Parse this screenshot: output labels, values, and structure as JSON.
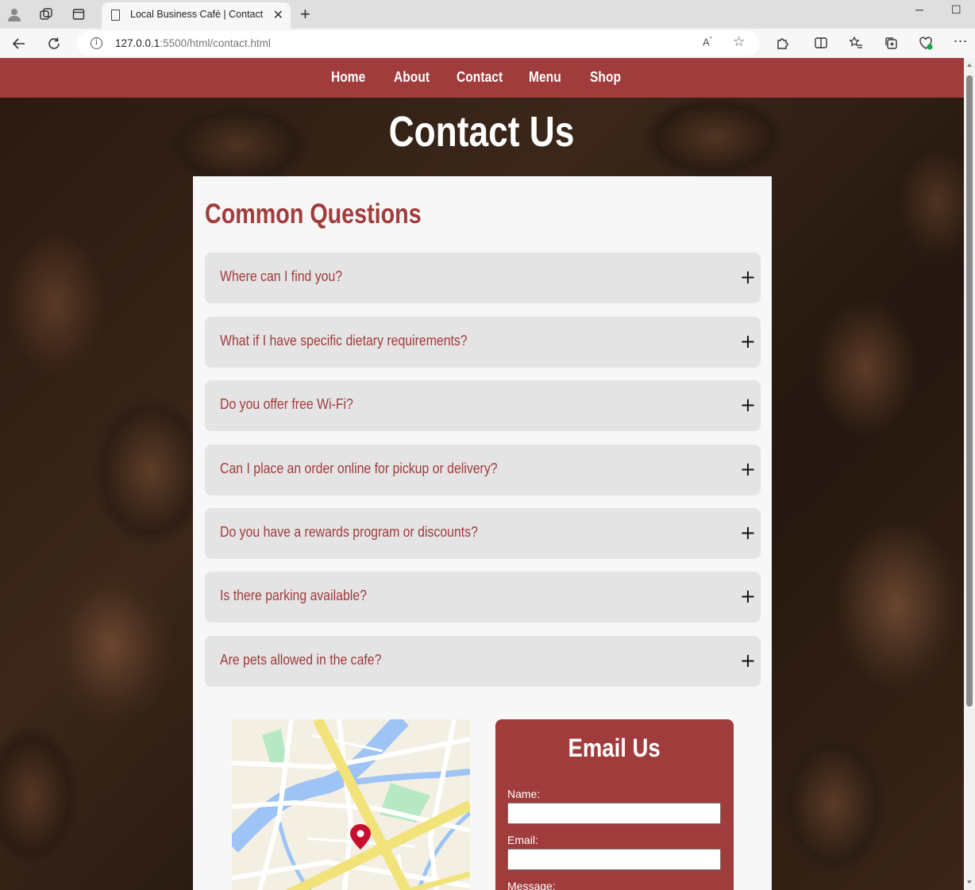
{
  "browser": {
    "tab_title": "Local Business Café | Contact",
    "url_host": "127.0.0.1",
    "url_rest": ":5500/html/contact.html"
  },
  "nav": {
    "items": [
      {
        "label": "Home"
      },
      {
        "label": "About"
      },
      {
        "label": "Contact"
      },
      {
        "label": "Menu"
      },
      {
        "label": "Shop"
      }
    ]
  },
  "hero": {
    "title": "Contact Us"
  },
  "faq": {
    "title": "Common Questions",
    "expand_symbol": "+",
    "items": [
      {
        "question": "Where can I find you?"
      },
      {
        "question": "What if I have specific dietary requirements?"
      },
      {
        "question": "Do you offer free Wi-Fi?"
      },
      {
        "question": "Can I place an order online for pickup or delivery?"
      },
      {
        "question": "Do you have a rewards program or discounts?"
      },
      {
        "question": "Is there parking available?"
      },
      {
        "question": "Are pets allowed in the cafe?"
      }
    ]
  },
  "email_form": {
    "title": "Email Us",
    "name_label": "Name:",
    "email_label": "Email:",
    "message_label": "Message:"
  },
  "colors": {
    "brand": "#a13c3c",
    "card_bg": "#f7f7f7",
    "faq_bg": "#e4e4e4"
  }
}
